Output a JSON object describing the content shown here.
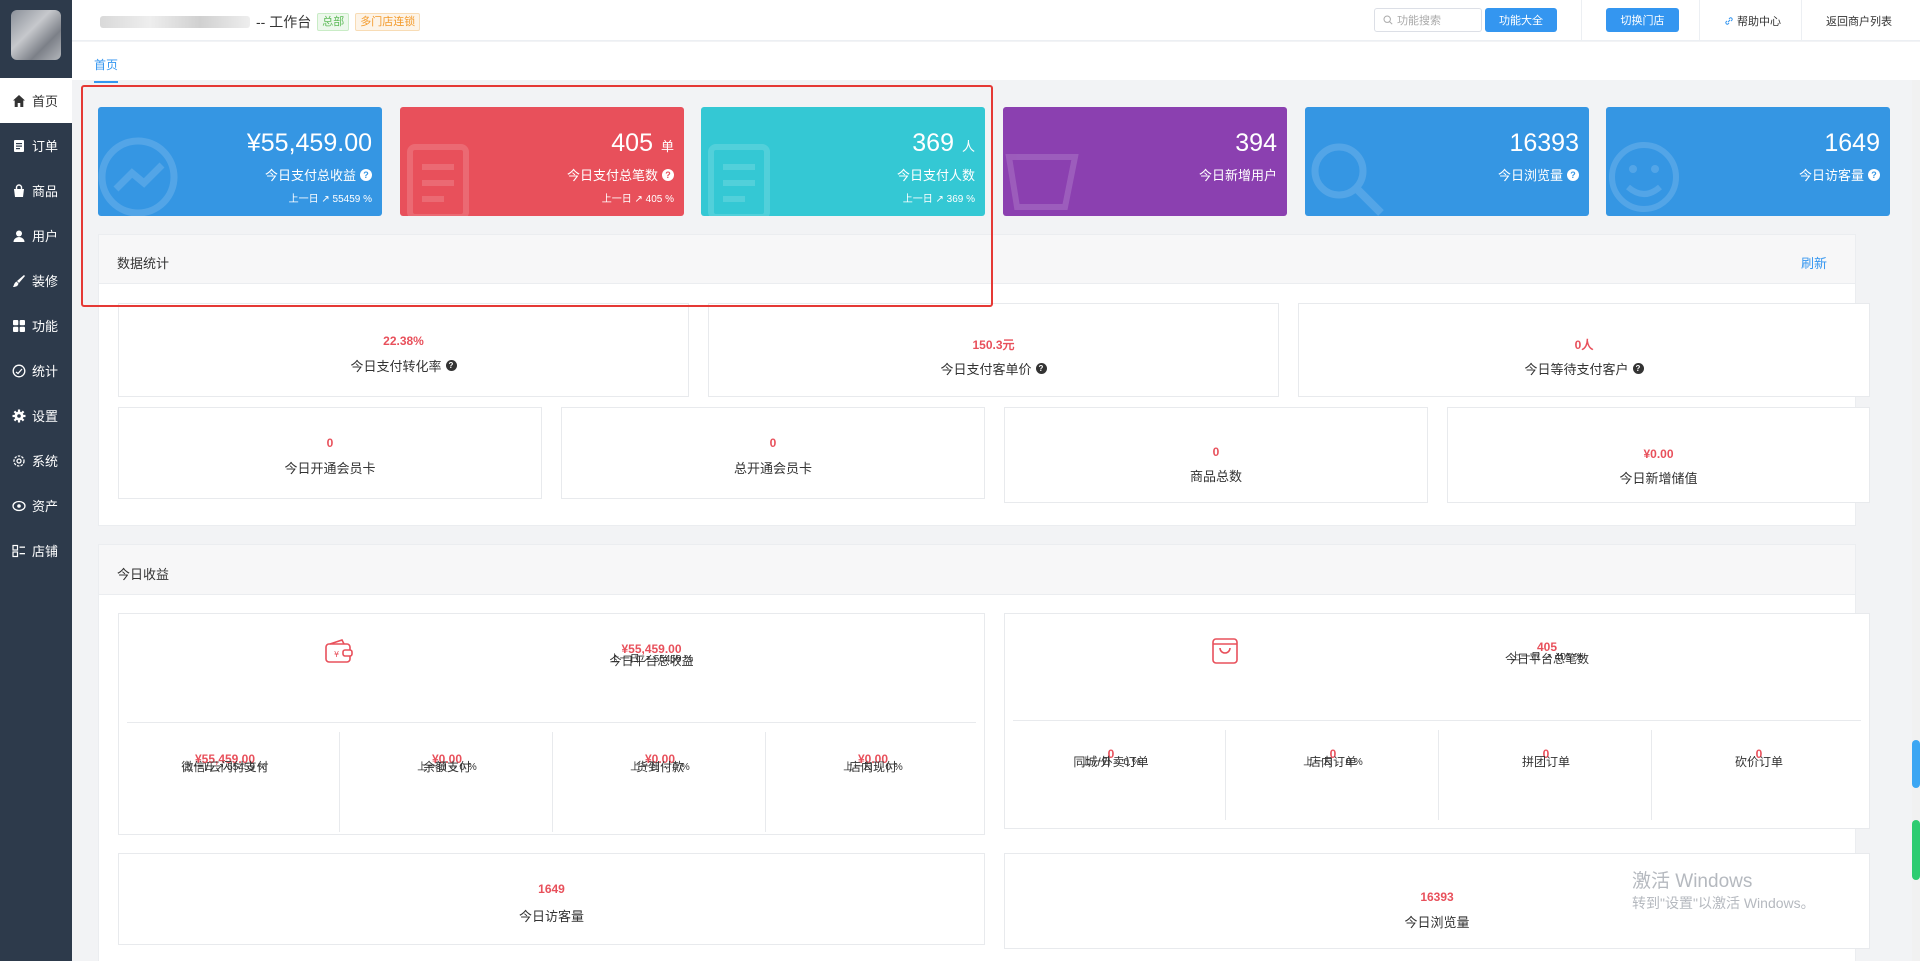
{
  "sidebar": {
    "items": [
      {
        "label": "首页",
        "icon": "home-icon",
        "active": true
      },
      {
        "label": "订单",
        "icon": "order-icon"
      },
      {
        "label": "商品",
        "icon": "bag-icon"
      },
      {
        "label": "用户",
        "icon": "user-icon"
      },
      {
        "label": "装修",
        "icon": "brush-icon"
      },
      {
        "label": "功能",
        "icon": "grid-icon"
      },
      {
        "label": "统计",
        "icon": "stats-icon"
      },
      {
        "label": "设置",
        "icon": "gear-icon"
      },
      {
        "label": "系统",
        "icon": "system-gear-icon"
      },
      {
        "label": "资产",
        "icon": "asset-icon"
      },
      {
        "label": "店铺",
        "icon": "store-icon"
      }
    ]
  },
  "header": {
    "title_suffix": "-- 工作台",
    "tag_hq": "总部",
    "tag_chain": "多门店连锁",
    "search_placeholder": "功能搜索",
    "all_functions": "功能大全",
    "switch_store": "切换门店",
    "help_center": "帮助中心",
    "back_to_list": "返回商户列表"
  },
  "tabs": {
    "home": "首页"
  },
  "cards": [
    {
      "value": "¥55,459.00",
      "unit": "",
      "label": "今日支付总收益",
      "help": true,
      "sub": "上一日 ↗ 55459 %",
      "color": "#3596e3"
    },
    {
      "value": "405",
      "unit": "单",
      "label": "今日支付总笔数",
      "help": true,
      "sub": "上一日 ↗ 405 %",
      "color": "#e8505b"
    },
    {
      "value": "369",
      "unit": "人",
      "label": "今日支付人数",
      "help": false,
      "sub": "上一日 ↗ 369 %",
      "color": "#34c8d4"
    },
    {
      "value": "394",
      "unit": "",
      "label": "今日新增用户",
      "help": false,
      "sub": "",
      "color": "#8b40b0"
    },
    {
      "value": "16393",
      "unit": "",
      "label": "今日浏览量",
      "help": true,
      "sub": "",
      "color": "#3596e3"
    },
    {
      "value": "1649",
      "unit": "",
      "label": "今日访客量",
      "help": true,
      "sub": "",
      "color": "#3596e3"
    }
  ],
  "data_stats": {
    "title": "数据统计",
    "refresh": "刷新",
    "row1": [
      {
        "value": "22.38%",
        "label": "今日支付转化率"
      },
      {
        "value": "150.3元",
        "label": "今日支付客单价"
      },
      {
        "value": "0人",
        "label": "今日等待支付客户"
      }
    ],
    "row2": [
      {
        "value": "0",
        "label": "今日开通会员卡"
      },
      {
        "value": "0",
        "label": "总开通会员卡"
      },
      {
        "value": "0",
        "label": "商品总数"
      },
      {
        "value": "¥0.00",
        "label": "今日新增储值"
      }
    ]
  },
  "revenue": {
    "title": "今日收益",
    "platform_income": {
      "value": "¥55,459.00",
      "label": "今日平台总收益",
      "sub": "上一日 ↗ 55459 %"
    },
    "payments": [
      {
        "value": "¥55,459.00",
        "label": "微信/云闪付支付",
        "sub": "上一日 ↗ 55459 %"
      },
      {
        "value": "¥0.00",
        "label": "余额支付",
        "sub": "上一日 -- 0 %"
      },
      {
        "value": "¥0.00",
        "label": "货到付款",
        "sub": "上一日 -- 0 %"
      },
      {
        "value": "¥0.00",
        "label": "店内现付",
        "sub": "上一日 -- 0 %"
      }
    ],
    "platform_orders": {
      "value": "405",
      "label": "今日平台总笔数",
      "sub": "上一日 ↗ 405 %"
    },
    "orders": [
      {
        "value": "0",
        "label": "同城/外卖订单",
        "sub": "上一日 -- 0 %"
      },
      {
        "value": "0",
        "label": "店内订单",
        "sub": "上一日 -- 0 %"
      },
      {
        "value": "0",
        "label": "拼团订单",
        "sub": ""
      },
      {
        "value": "0",
        "label": "砍价订单",
        "sub": ""
      }
    ],
    "visitors": {
      "value": "1649",
      "label": "今日访客量"
    },
    "views": {
      "value": "16393",
      "label": "今日浏览量"
    }
  },
  "watermark": {
    "line1": "激活 Windows",
    "line2": "转到\"设置\"以激活 Windows。"
  }
}
